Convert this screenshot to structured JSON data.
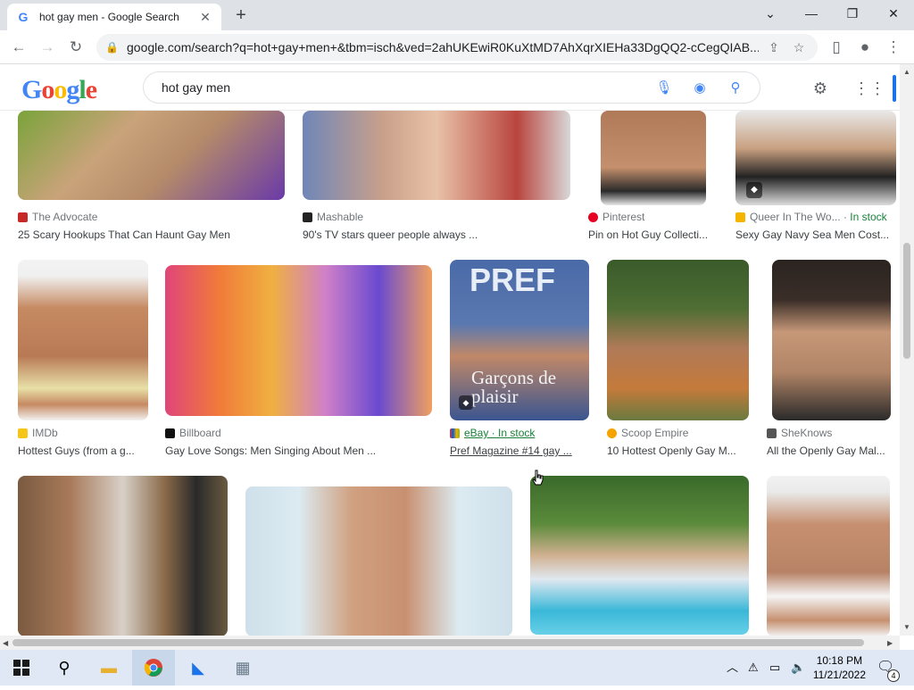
{
  "browser": {
    "tab_title": "hot gay men - Google Search",
    "url": "google.com/search?q=hot+gay+men+&tbm=isch&ved=2ahUKEwiR0KuXtMD7AhXqrXIEHa33DgQQ2-cCegQIAB...",
    "new_tab": "+",
    "close_tab": "✕",
    "minimize": "—",
    "maximize": "❐",
    "close_window": "✕"
  },
  "google": {
    "logo": "Google",
    "query": "hot gay men"
  },
  "results": {
    "row1": [
      {
        "source": "The Advocate",
        "stock": "",
        "caption": "25 Scary Hookups That Can Haunt Gay Men",
        "color": "#c62828"
      },
      {
        "source": "Mashable",
        "stock": "",
        "caption": "90's TV stars queer people always ...",
        "color": "#222222"
      },
      {
        "source": "Pinterest",
        "stock": "",
        "caption": "Pin on Hot Guy Collecti...",
        "color": "#e60023"
      },
      {
        "source": "Queer In The Wo...",
        "stock": "In stock",
        "caption": "Sexy Gay Navy Sea Men Cost...",
        "color": "#f4b400"
      }
    ],
    "row2": [
      {
        "source": "IMDb",
        "stock": "",
        "caption": "Hottest Guys (from a g...",
        "color": "#f5c518"
      },
      {
        "source": "Billboard",
        "stock": "",
        "caption": "Gay Love Songs: Men Singing About Men ...",
        "color": "#111111"
      },
      {
        "source": "eBay · In stock",
        "stock": "",
        "caption": "Pref Magazine #14 gay ...",
        "color": "#e53238"
      },
      {
        "source": "Scoop Empire",
        "stock": "",
        "caption": "10 Hottest Openly Gay M...",
        "color": "#f4a300"
      },
      {
        "source": "SheKnows",
        "stock": "",
        "caption": "All the Openly Gay Mal...",
        "color": "#555555"
      }
    ]
  },
  "thumbs": {
    "magazine_title": "PREF",
    "magazine_cover": "Garçons de plaisir"
  },
  "taskbar": {
    "time": "10:18 PM",
    "date": "11/21/2022",
    "notif_count": "4"
  }
}
